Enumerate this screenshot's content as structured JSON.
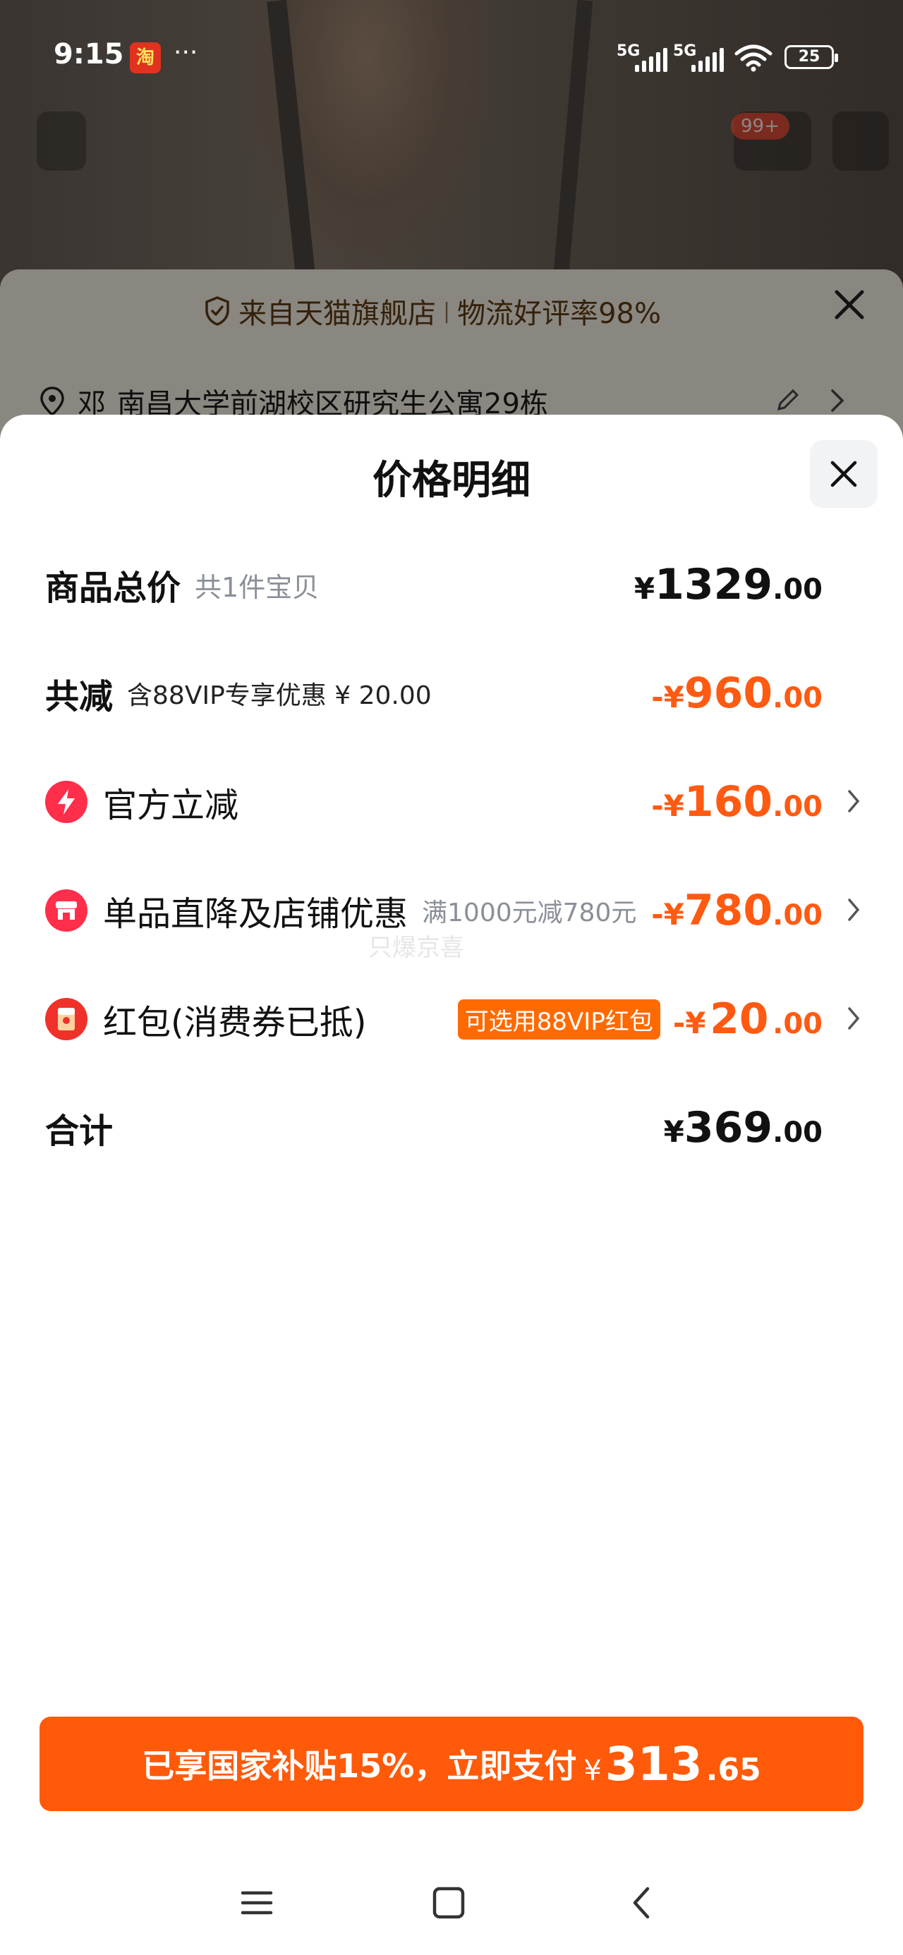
{
  "status_bar": {
    "time": "9:15",
    "app_icon_glyph": "淘",
    "overflow_dots": "···",
    "net1": "5G",
    "net2": "5G",
    "battery": "25"
  },
  "background": {
    "badge": "99+",
    "notice_text": "来自天猫旗舰店",
    "notice_sep": "|",
    "notice_rating": "物流好评率98%",
    "address_name": "邓",
    "address": "南昌大学前湖校区研究生公寓29栋"
  },
  "sheet": {
    "title": "价格明细",
    "rows": {
      "total": {
        "label": "商品总价",
        "sub": "共1件宝贝",
        "sym": "¥",
        "int": "1329",
        "dec": ".00"
      },
      "discount": {
        "label": "共减",
        "sub": "含88VIP专享优惠 ¥ 20.00",
        "sym": "-¥",
        "int": "960",
        "dec": ".00"
      },
      "official": {
        "label": "官方立减",
        "sym": "-¥",
        "int": "160",
        "dec": ".00"
      },
      "store": {
        "label": "单品直降及店铺优惠",
        "sub": "满1000元减780元",
        "sym": "-¥",
        "int": "780",
        "dec": ".00"
      },
      "redpacket": {
        "label": "红包(消费券已抵)",
        "tag": "可选用88VIP红包",
        "sym": "-¥",
        "int": "20",
        "dec": ".00"
      },
      "sum": {
        "label": "合计",
        "sym": "¥",
        "int": "369",
        "dec": ".00"
      }
    },
    "watermark": "只爆京喜"
  },
  "pay_button": {
    "text": "已享国家补贴15%，立即支付",
    "sym": "¥",
    "int": "313",
    "dec": ".65"
  },
  "colors": {
    "accent": "#ff5a0a",
    "discount_text": "#ff5a12",
    "icon_red": "#ff2e4a",
    "tag_orange": "#ff6a00"
  }
}
